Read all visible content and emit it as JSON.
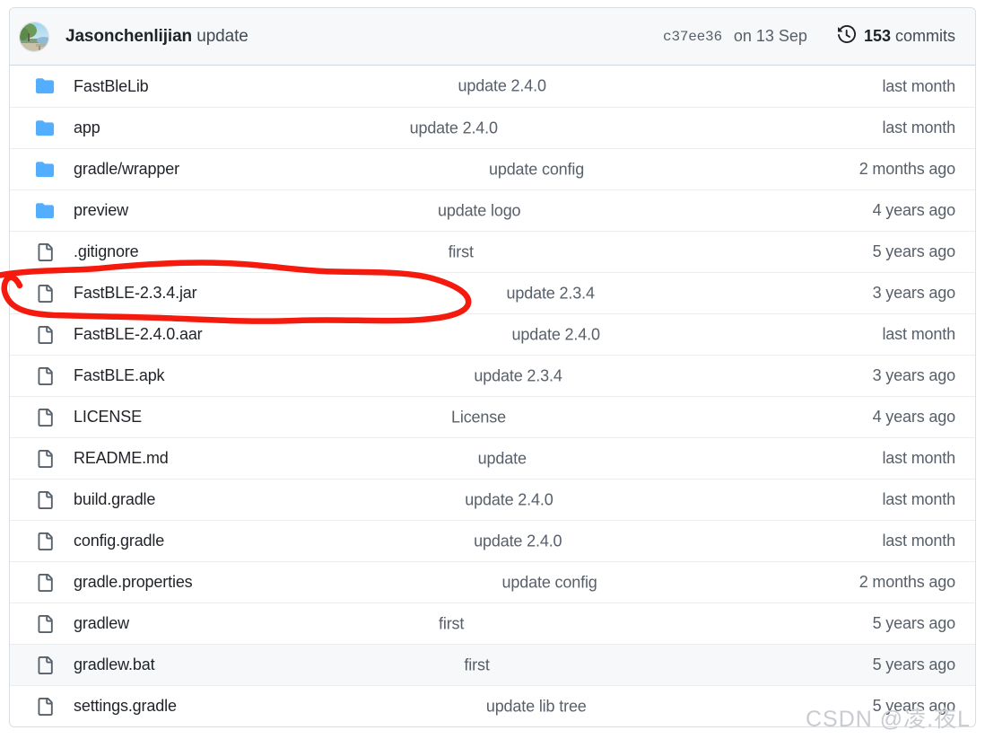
{
  "header": {
    "avatar_alt": "Jasonchenlijian avatar",
    "author": "Jasonchenlijian",
    "commit_message": "update",
    "commit_sha": "c37ee36",
    "commit_date": "on 13 Sep",
    "commits_count": "153",
    "commits_label": "commits",
    "history_icon": "history-icon"
  },
  "colors": {
    "folder_blue": "#54aeff",
    "file_gray": "#57606a",
    "annotation_red": "#f51a0e",
    "header_bg": "#f6f8fa",
    "border": "#d0d7de",
    "row_border": "#eaeef2",
    "active_row_bg": "#f6f8fa",
    "text_primary": "#1f2328",
    "text_secondary": "#57606a",
    "watermark": "#c8ccd1"
  },
  "files": [
    {
      "name": "FastBleLib",
      "type": "folder",
      "message": "update 2.4.0",
      "time": "last month",
      "active": false,
      "annotated": false
    },
    {
      "name": "app",
      "type": "folder",
      "message": "update 2.4.0",
      "time": "last month",
      "active": false,
      "annotated": false
    },
    {
      "name": "gradle/wrapper",
      "type": "folder",
      "message": "update config",
      "time": "2 months ago",
      "active": false,
      "annotated": false
    },
    {
      "name": "preview",
      "type": "folder",
      "message": "update logo",
      "time": "4 years ago",
      "active": false,
      "annotated": false
    },
    {
      "name": ".gitignore",
      "type": "file",
      "message": "first",
      "time": "5 years ago",
      "active": false,
      "annotated": false
    },
    {
      "name": "FastBLE-2.3.4.jar",
      "type": "file",
      "message": "update 2.3.4",
      "time": "3 years ago",
      "active": false,
      "annotated": true
    },
    {
      "name": "FastBLE-2.4.0.aar",
      "type": "file",
      "message": "update 2.4.0",
      "time": "last month",
      "active": false,
      "annotated": false
    },
    {
      "name": "FastBLE.apk",
      "type": "file",
      "message": "update 2.3.4",
      "time": "3 years ago",
      "active": false,
      "annotated": false
    },
    {
      "name": "LICENSE",
      "type": "file",
      "message": "License",
      "time": "4 years ago",
      "active": false,
      "annotated": false
    },
    {
      "name": "README.md",
      "type": "file",
      "message": "update",
      "time": "last month",
      "active": false,
      "annotated": false
    },
    {
      "name": "build.gradle",
      "type": "file",
      "message": "update 2.4.0",
      "time": "last month",
      "active": false,
      "annotated": false
    },
    {
      "name": "config.gradle",
      "type": "file",
      "message": "update 2.4.0",
      "time": "last month",
      "active": false,
      "annotated": false
    },
    {
      "name": "gradle.properties",
      "type": "file",
      "message": "update config",
      "time": "2 months ago",
      "active": false,
      "annotated": false
    },
    {
      "name": "gradlew",
      "type": "file",
      "message": "first",
      "time": "5 years ago",
      "active": false,
      "annotated": false
    },
    {
      "name": "gradlew.bat",
      "type": "file",
      "message": "first",
      "time": "5 years ago",
      "active": true,
      "annotated": false
    },
    {
      "name": "settings.gradle",
      "type": "file",
      "message": "update lib tree",
      "time": "5 years ago",
      "active": false,
      "annotated": false
    }
  ],
  "annotation": {
    "shape": "hand-drawn-red-ellipse",
    "target": "FastBLE-2.3.4.jar"
  },
  "watermark": {
    "text": "CSDN @凌.夜L"
  }
}
